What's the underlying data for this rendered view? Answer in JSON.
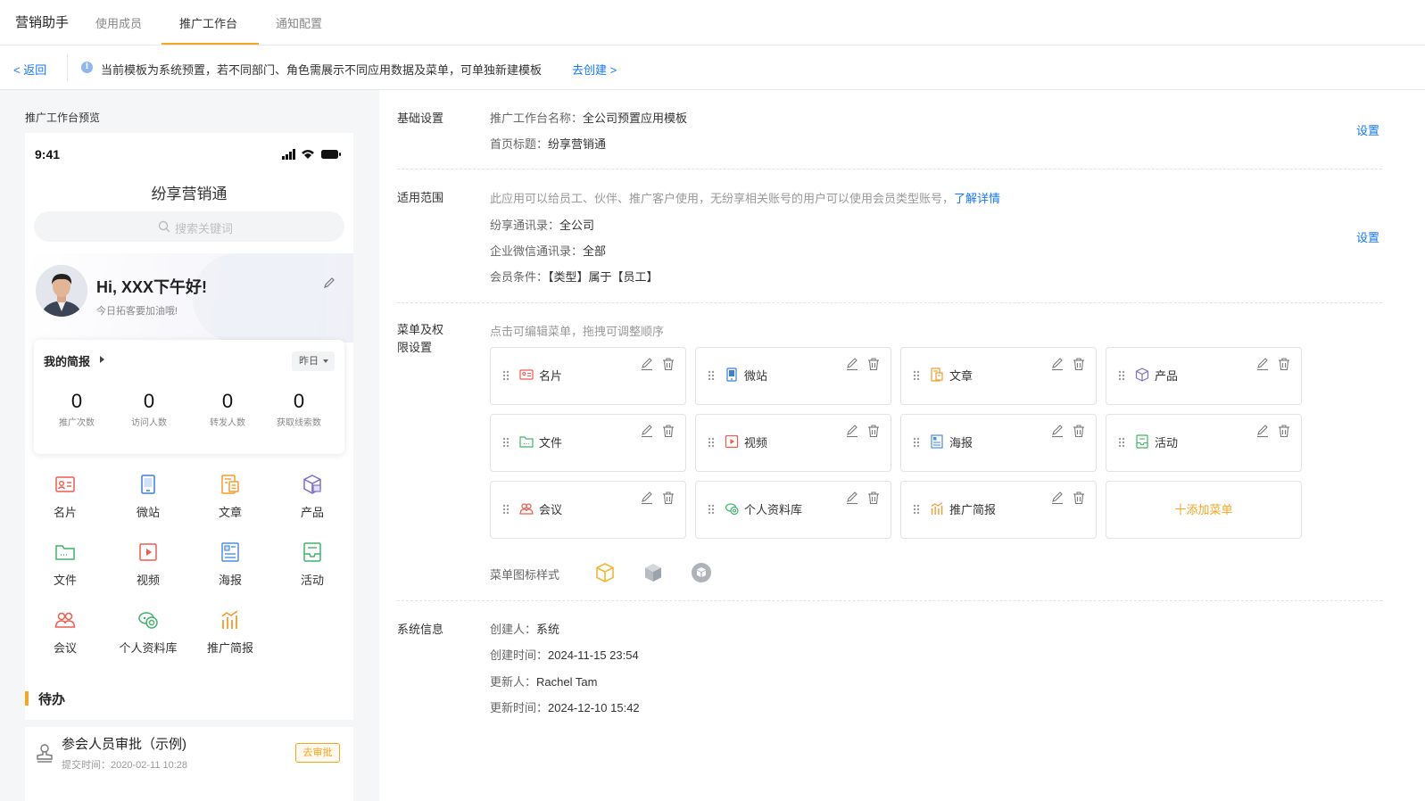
{
  "app": {
    "title": "营销助手"
  },
  "tabs": [
    {
      "label": "使用成员"
    },
    {
      "label": "推广工作台"
    },
    {
      "label": "通知配置"
    }
  ],
  "notice": {
    "back": "< 返回",
    "text": "当前模板为系统预置，若不同部门、角色需展示不同应用数据及菜单，可单独新建模板",
    "link": "去创建 >"
  },
  "preview": {
    "title": "推广工作台预览",
    "status_time": "9:41",
    "phone_title": "纷享营销通",
    "search_placeholder": "搜索关键词",
    "greeting": "Hi, XXX下午好!",
    "greeting_sub": "今日拓客要加油哦!",
    "brief": {
      "title": "我的简报",
      "range": "昨日",
      "stats": [
        {
          "value": "0",
          "label": "推广次数"
        },
        {
          "value": "0",
          "label": "访问人数"
        },
        {
          "value": "0",
          "label": "转发人数"
        },
        {
          "value": "0",
          "label": "获取线索数"
        }
      ]
    },
    "apps": [
      {
        "name": "名片",
        "icon": "card-icon"
      },
      {
        "name": "微站",
        "icon": "site-icon"
      },
      {
        "name": "文章",
        "icon": "article-icon"
      },
      {
        "name": "产品",
        "icon": "product-icon"
      },
      {
        "name": "文件",
        "icon": "file-icon"
      },
      {
        "name": "视频",
        "icon": "video-icon"
      },
      {
        "name": "海报",
        "icon": "poster-icon"
      },
      {
        "name": "活动",
        "icon": "activity-icon"
      },
      {
        "name": "会议",
        "icon": "meeting-icon"
      },
      {
        "name": "个人资料库",
        "icon": "library-icon"
      },
      {
        "name": "推广简报",
        "icon": "report-icon"
      }
    ],
    "todo": {
      "heading": "待办",
      "title": "参会人员审批（示例)",
      "time": "提交时间：2020-02-11 10:28",
      "button": "去审批"
    }
  },
  "basic": {
    "label": "基础设置",
    "name_key": "推广工作台名称：",
    "name_val": "全公司预置应用模板",
    "home_key": "首页标题：",
    "home_val": "纷享营销通",
    "set": "设置"
  },
  "scope": {
    "label": "适用范围",
    "desc": "此应用可以给员工、伙伴、推广客户使用，无纷享相关账号的用户可以使用会员类型账号，",
    "desc_link": "了解详情",
    "contacts_key": "纷享通讯录：",
    "contacts_val": "全公司",
    "wecom_key": "企业微信通讯录：",
    "wecom_val": "全部",
    "member_key": "会员条件：",
    "member_val": "【类型】属于【员工】",
    "set": "设置"
  },
  "menu": {
    "label_line1": "菜单及权",
    "label_line2": "限设置",
    "hint": "点击可编辑菜单，拖拽可调整顺序",
    "items": [
      {
        "label": "名片",
        "icon": "card-icon"
      },
      {
        "label": "微站",
        "icon": "site-icon"
      },
      {
        "label": "文章",
        "icon": "article-icon"
      },
      {
        "label": "产品",
        "icon": "product-icon"
      },
      {
        "label": "文件",
        "icon": "file-icon"
      },
      {
        "label": "视频",
        "icon": "video-icon"
      },
      {
        "label": "海报",
        "icon": "poster-icon"
      },
      {
        "label": "活动",
        "icon": "activity-icon"
      },
      {
        "label": "会议",
        "icon": "meeting-icon"
      },
      {
        "label": "个人资料库",
        "icon": "library-icon"
      },
      {
        "label": "推广简报",
        "icon": "report-icon"
      }
    ],
    "add": "十添加菜单",
    "style_label": "菜单图标样式"
  },
  "sysinfo": {
    "label": "系统信息",
    "creator_key": "创建人：",
    "creator_val": "系统",
    "created_key": "创建时间：",
    "created_val": "2024-11-15 23:54",
    "updater_key": "更新人：",
    "updater_val": "Rachel Tam",
    "updated_key": "更新时间：",
    "updated_val": "2024-12-10 15:42"
  },
  "colors": {
    "accent": "#f5a623",
    "link": "#1677ff",
    "red": "#ef5b4c",
    "blue": "#3b7ddd",
    "orange": "#f39b2c",
    "purple": "#7c6fd1",
    "green": "#3fb36b",
    "teal": "#4a90e2"
  }
}
